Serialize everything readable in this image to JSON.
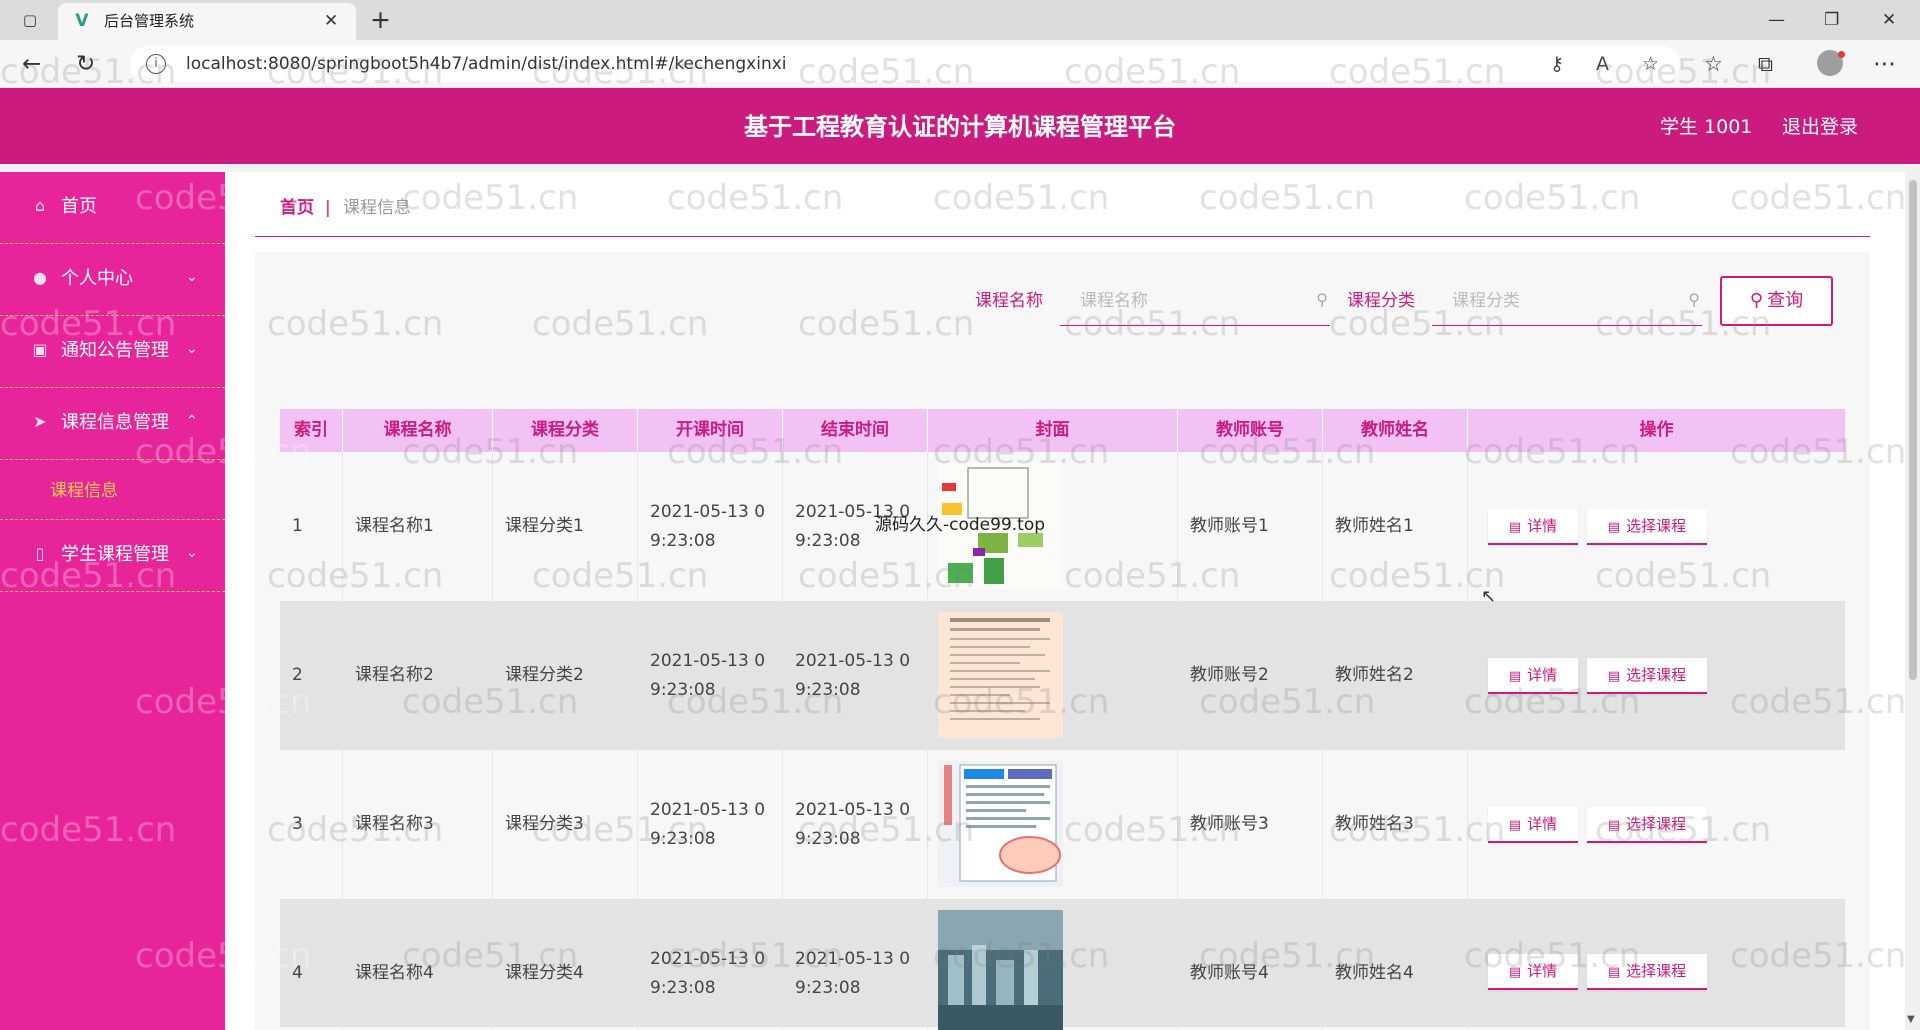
{
  "browser": {
    "tab_title": "后台管理系统",
    "url": "localhost:8080/springboot5h4b7/admin/dist/index.html#/kechengxinxi"
  },
  "header": {
    "title": "基于工程教育认证的计算机课程管理平台",
    "user": "学生 1001",
    "logout": "退出登录"
  },
  "sidebar": {
    "items": [
      {
        "label": "首页",
        "icon": "home-icon"
      },
      {
        "label": "个人中心",
        "icon": "user-icon",
        "expanded": false
      },
      {
        "label": "通知公告管理",
        "icon": "notice-icon",
        "expanded": false
      },
      {
        "label": "课程信息管理",
        "icon": "send-icon",
        "expanded": true,
        "children": [
          {
            "label": "课程信息"
          }
        ]
      },
      {
        "label": "学生课程管理",
        "icon": "phone-icon",
        "expanded": false
      }
    ]
  },
  "breadcrumb": {
    "home": "首页",
    "separator": "|",
    "current": "课程信息"
  },
  "search": {
    "name_label": "课程名称",
    "name_placeholder": "课程名称",
    "category_label": "课程分类",
    "category_placeholder": "课程分类",
    "query_button": "查询"
  },
  "table": {
    "columns": [
      "索引",
      "课程名称",
      "课程分类",
      "开课时间",
      "结束时间",
      "封面",
      "教师账号",
      "教师姓名",
      "操作"
    ],
    "rows": [
      {
        "index": "1",
        "name": "课程名称1",
        "category": "课程分类1",
        "start": "2021-05-13 0\n9:23:08",
        "end": "2021-05-13 0\n9:23:08",
        "teacher_account": "教师账号1",
        "teacher_name": "教师姓名1"
      },
      {
        "index": "2",
        "name": "课程名称2",
        "category": "课程分类2",
        "start": "2021-05-13 0\n9:23:08",
        "end": "2021-05-13 0\n9:23:08",
        "teacher_account": "教师账号2",
        "teacher_name": "教师姓名2"
      },
      {
        "index": "3",
        "name": "课程名称3",
        "category": "课程分类3",
        "start": "2021-05-13 0\n9:23:08",
        "end": "2021-05-13 0\n9:23:08",
        "teacher_account": "教师账号3",
        "teacher_name": "教师姓名3"
      },
      {
        "index": "4",
        "name": "课程名称4",
        "category": "课程分类4",
        "start": "2021-05-13 0\n9:23:08",
        "end": "2021-05-13 0\n9:23:08",
        "teacher_account": "教师账号4",
        "teacher_name": "教师姓名4"
      }
    ],
    "detail_button": "详情",
    "select_button": "选择课程"
  },
  "overlay_text": "源码久久-code99.top",
  "watermark": "code51.cn",
  "colors": {
    "accent": "#cc1b7e",
    "sidebar": "#e8249a",
    "table_header": "#f2c2f4",
    "submenu_active": "#f6d24b"
  }
}
